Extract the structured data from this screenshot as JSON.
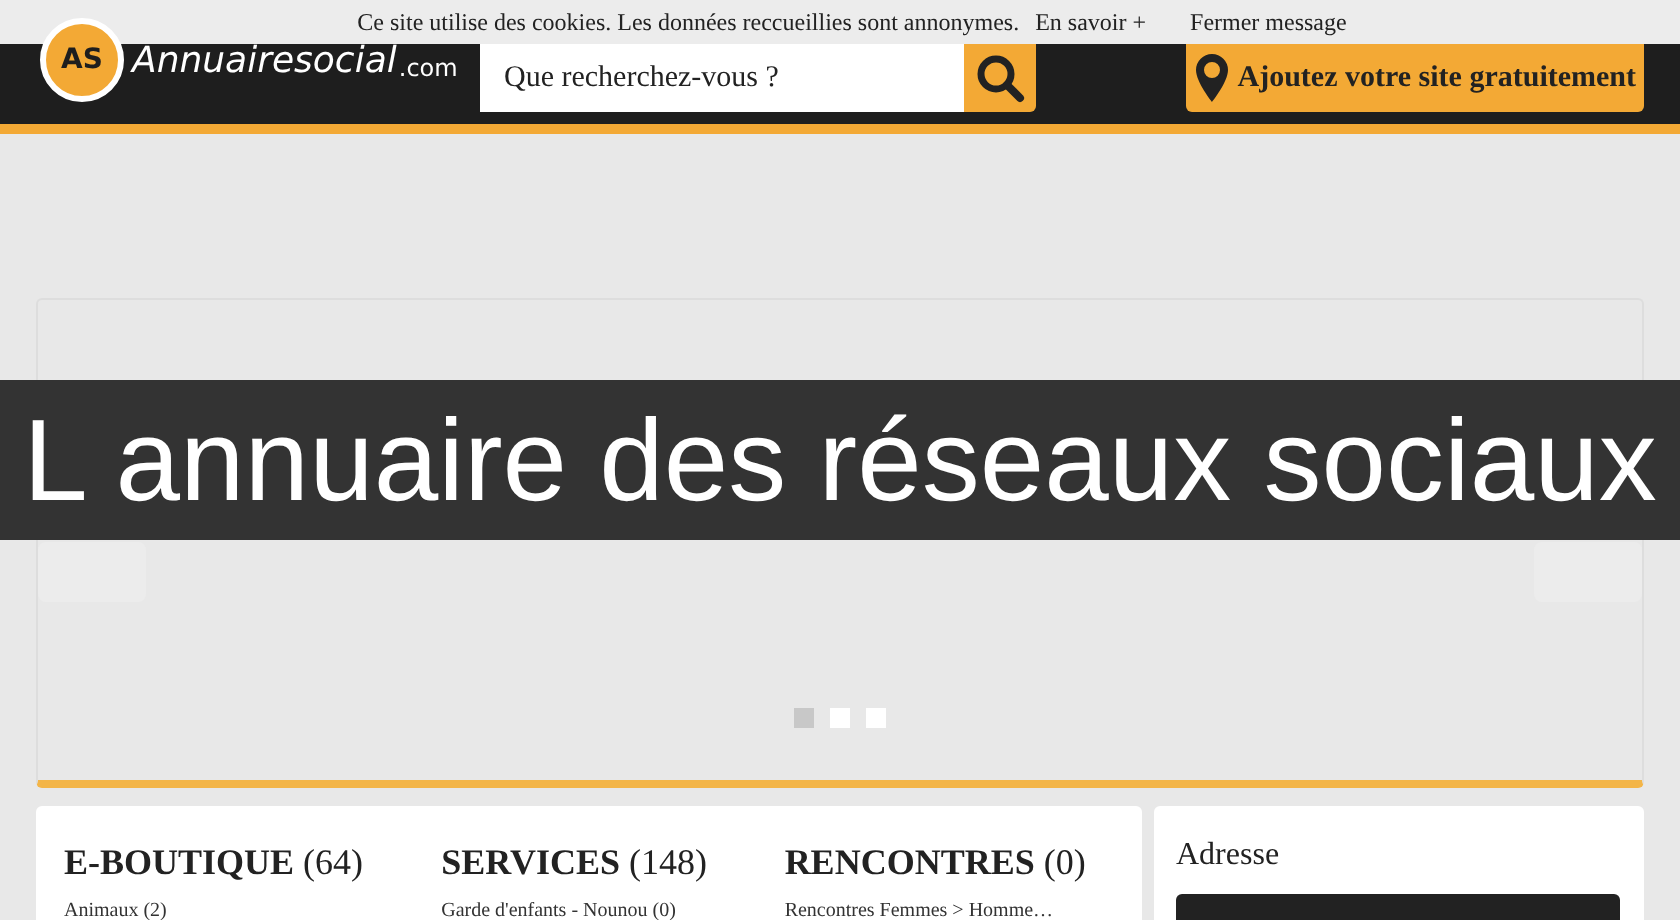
{
  "cookie_bar": {
    "message": "Ce site utilise des cookies. Les données reccueillies sont annonymes.",
    "more_link": "En savoir +",
    "close_link": "Fermer message"
  },
  "header": {
    "logo": {
      "mark": "AS",
      "name": "Annuairesocial",
      "suffix": ".com"
    },
    "search": {
      "placeholder": "Que recherchez-vous ?"
    },
    "add_button": "Ajoutez votre site gratuitement"
  },
  "banner": {
    "title": "L annuaire des réseaux sociaux"
  },
  "slider": {
    "dots": [
      {
        "selected": true
      },
      {
        "selected": false
      },
      {
        "selected": false
      }
    ]
  },
  "categories": [
    {
      "name": "E-BOUTIQUE",
      "count": "(64)",
      "items": [
        "Animaux (2)"
      ]
    },
    {
      "name": "SERVICES",
      "count": "(148)",
      "items": [
        "Garde d'enfants - Nounou (0)"
      ]
    },
    {
      "name": "RENCONTRES",
      "count": "(0)",
      "items": [
        "Rencontres Femmes > Homme…"
      ]
    }
  ],
  "sidebar": {
    "title": "Adresse"
  }
}
